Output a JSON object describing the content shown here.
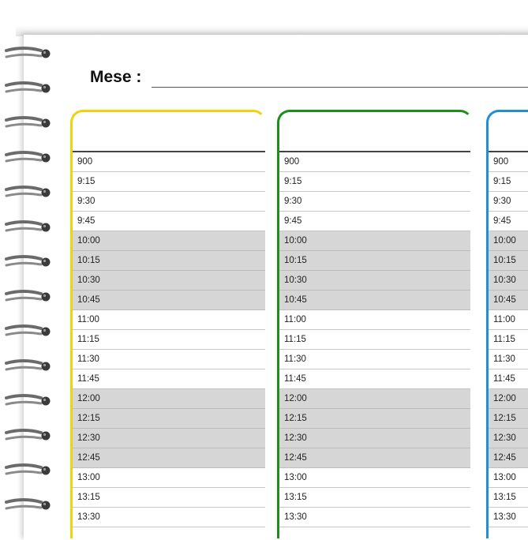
{
  "header": {
    "month_label": "Mese :"
  },
  "spiral": {
    "rings": 14
  },
  "colors": {
    "column_1": "#f2d20f",
    "column_2": "#1a8f1a",
    "column_3": "#1f8fd6",
    "shaded_slot": "#d6d6d6"
  },
  "columns": [
    {
      "slots": [
        "900",
        "9:15",
        "9:30",
        "9:45",
        "10:00",
        "10:15",
        "10:30",
        "10:45",
        "11:00",
        "11:15",
        "11:30",
        "11:45",
        "12:00",
        "12:15",
        "12:30",
        "12:45",
        "13:00",
        "13:15",
        "13:30"
      ]
    },
    {
      "slots": [
        "900",
        "9:15",
        "9:30",
        "9:45",
        "10:00",
        "10:15",
        "10:30",
        "10:45",
        "11:00",
        "11:15",
        "11:30",
        "11:45",
        "12:00",
        "12:15",
        "12:30",
        "12:45",
        "13:00",
        "13:15",
        "13:30"
      ]
    },
    {
      "slots": [
        "900",
        "9:15",
        "9:30",
        "9:45",
        "10:00",
        "10:15",
        "10:30",
        "10:45",
        "11:00",
        "11:15",
        "11:30",
        "11:45",
        "12:00",
        "12:15",
        "12:30",
        "12:45",
        "13:00",
        "13:15",
        "13:30"
      ]
    }
  ],
  "shaded_hours": [
    "10",
    "12"
  ]
}
